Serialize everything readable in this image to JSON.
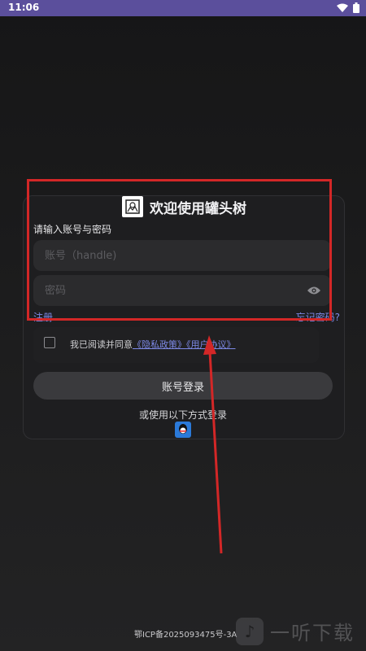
{
  "status_bar": {
    "time": "11:06"
  },
  "login": {
    "title": "欢迎使用罐头树",
    "subtitle": "请输入账号与密码",
    "account_placeholder": "账号（handle)",
    "password_placeholder": "密码",
    "register": "注册",
    "forgot": "忘记密码?",
    "agree_prefix": "我已阅读并同意",
    "privacy": "《隐私政策》",
    "terms": "《用户协议》",
    "login_button": "账号登录",
    "alt_login": "或使用以下方式登录"
  },
  "footer": {
    "icp": "鄂ICP备2025093475号-3A"
  },
  "watermark": {
    "text": "一听下载"
  },
  "colors": {
    "status_bar": "#5b4f9c",
    "link": "#7d89e6",
    "annotation": "#d32727"
  }
}
